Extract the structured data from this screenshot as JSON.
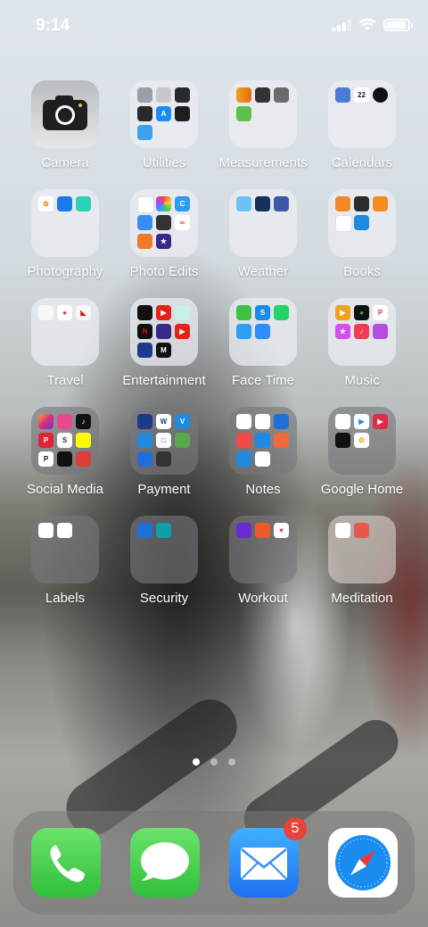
{
  "status_bar": {
    "time": "9:14"
  },
  "home": {
    "apps": [
      {
        "label": "Camera"
      },
      {
        "label": "Utilities",
        "tiles": [
          "#9aa0a8",
          "#b8bcc2",
          "#3a3a3c",
          "#2a2a2c",
          "#1c8df5",
          "#1e1e1e",
          "#3aa0f0"
        ]
      },
      {
        "label": "Measurements",
        "tiles": [
          "#f0a020",
          "#333333",
          "#6b6b6b",
          "#5fc04c"
        ]
      },
      {
        "label": "Calendars",
        "tiles": [
          "#4a7bd6",
          "#ffffff",
          "#111111"
        ],
        "tile_text": [
          "",
          "22",
          ""
        ]
      },
      {
        "label": "Photography",
        "tiles": [
          "#ffffff",
          "#1b7ae8",
          "#2bd1b5"
        ]
      },
      {
        "label": "Photo Edits",
        "tiles": [
          "#222222",
          "#ffffff",
          "#2b9cf2",
          "#3a8df0",
          "#333333",
          "#ffffff",
          "#f07a2a",
          "#3a2a88"
        ]
      },
      {
        "label": "Weather",
        "tiles": [
          "#6fc1f3",
          "#16325c",
          "#3a57a8"
        ]
      },
      {
        "label": "Books",
        "tiles": [
          "#f08a24",
          "#2c2c2c",
          "#f58b1f",
          "#ffffff",
          "#1f8ae0"
        ]
      },
      {
        "label": "Travel",
        "tiles": [
          "#f7f7f7",
          "#ffffff",
          "#f7f7f7"
        ]
      },
      {
        "label": "Entertainment",
        "tiles": [
          "#111111",
          "#e62117",
          "#c7f0e6",
          "#e50914",
          "#3a2a88",
          "#e62117",
          "#1a3a8a",
          "#111111"
        ]
      },
      {
        "label": "Face Time",
        "tiles": [
          "#3fc146",
          "#1b8ae8",
          "#25d366",
          "#2f9ef0",
          "#2d8cff"
        ]
      },
      {
        "label": "Music",
        "tiles": [
          "#f0a21d",
          "#111111",
          "#ffffff",
          "#d64df0",
          "#f43a52",
          "#b34ee0"
        ]
      },
      {
        "label": "Social Media",
        "tiles": [
          "#d62d7a",
          "#e94a8c",
          "#111111",
          "#e0243a",
          "#ffffff",
          "#fffc00",
          "#ffffff",
          "#111111",
          "#e23b3b"
        ]
      },
      {
        "label": "Payment",
        "tiles": [
          "#1a3a8a",
          "#ffffff",
          "#1f8ae0",
          "#1f8ae0",
          "#ffffff",
          "#5aa84a",
          "#1f6fd8",
          "#333333"
        ]
      },
      {
        "label": "Notes",
        "tiles": [
          "#ffffff",
          "#ffffff",
          "#1f6fd8",
          "#f04a4a",
          "#1f8ae0",
          "#f06a3a",
          "#1f8ae0",
          "#ffffff"
        ]
      },
      {
        "label": "Google Home",
        "tiles": [
          "#ffffff",
          "#ffffff",
          "#e22a4a",
          "#111111",
          "#ffffff"
        ]
      },
      {
        "label": "Labels",
        "tiles": [
          "#ffffff",
          "#ffffff"
        ]
      },
      {
        "label": "Security",
        "tiles": [
          "#1f6fd8",
          "#0aa2a8"
        ]
      },
      {
        "label": "Workout",
        "tiles": [
          "#6a2ad0",
          "#f05a28",
          "#ffffff"
        ]
      },
      {
        "label": "Meditation",
        "tiles": [
          "#ffffff",
          "#e45a4a"
        ]
      }
    ]
  },
  "page_indicator": {
    "pages": 3,
    "current": 1
  },
  "dock": {
    "phone_name": "Phone",
    "messages_name": "Messages",
    "mail_name": "Mail",
    "mail_badge": "5",
    "safari_name": "Safari"
  }
}
